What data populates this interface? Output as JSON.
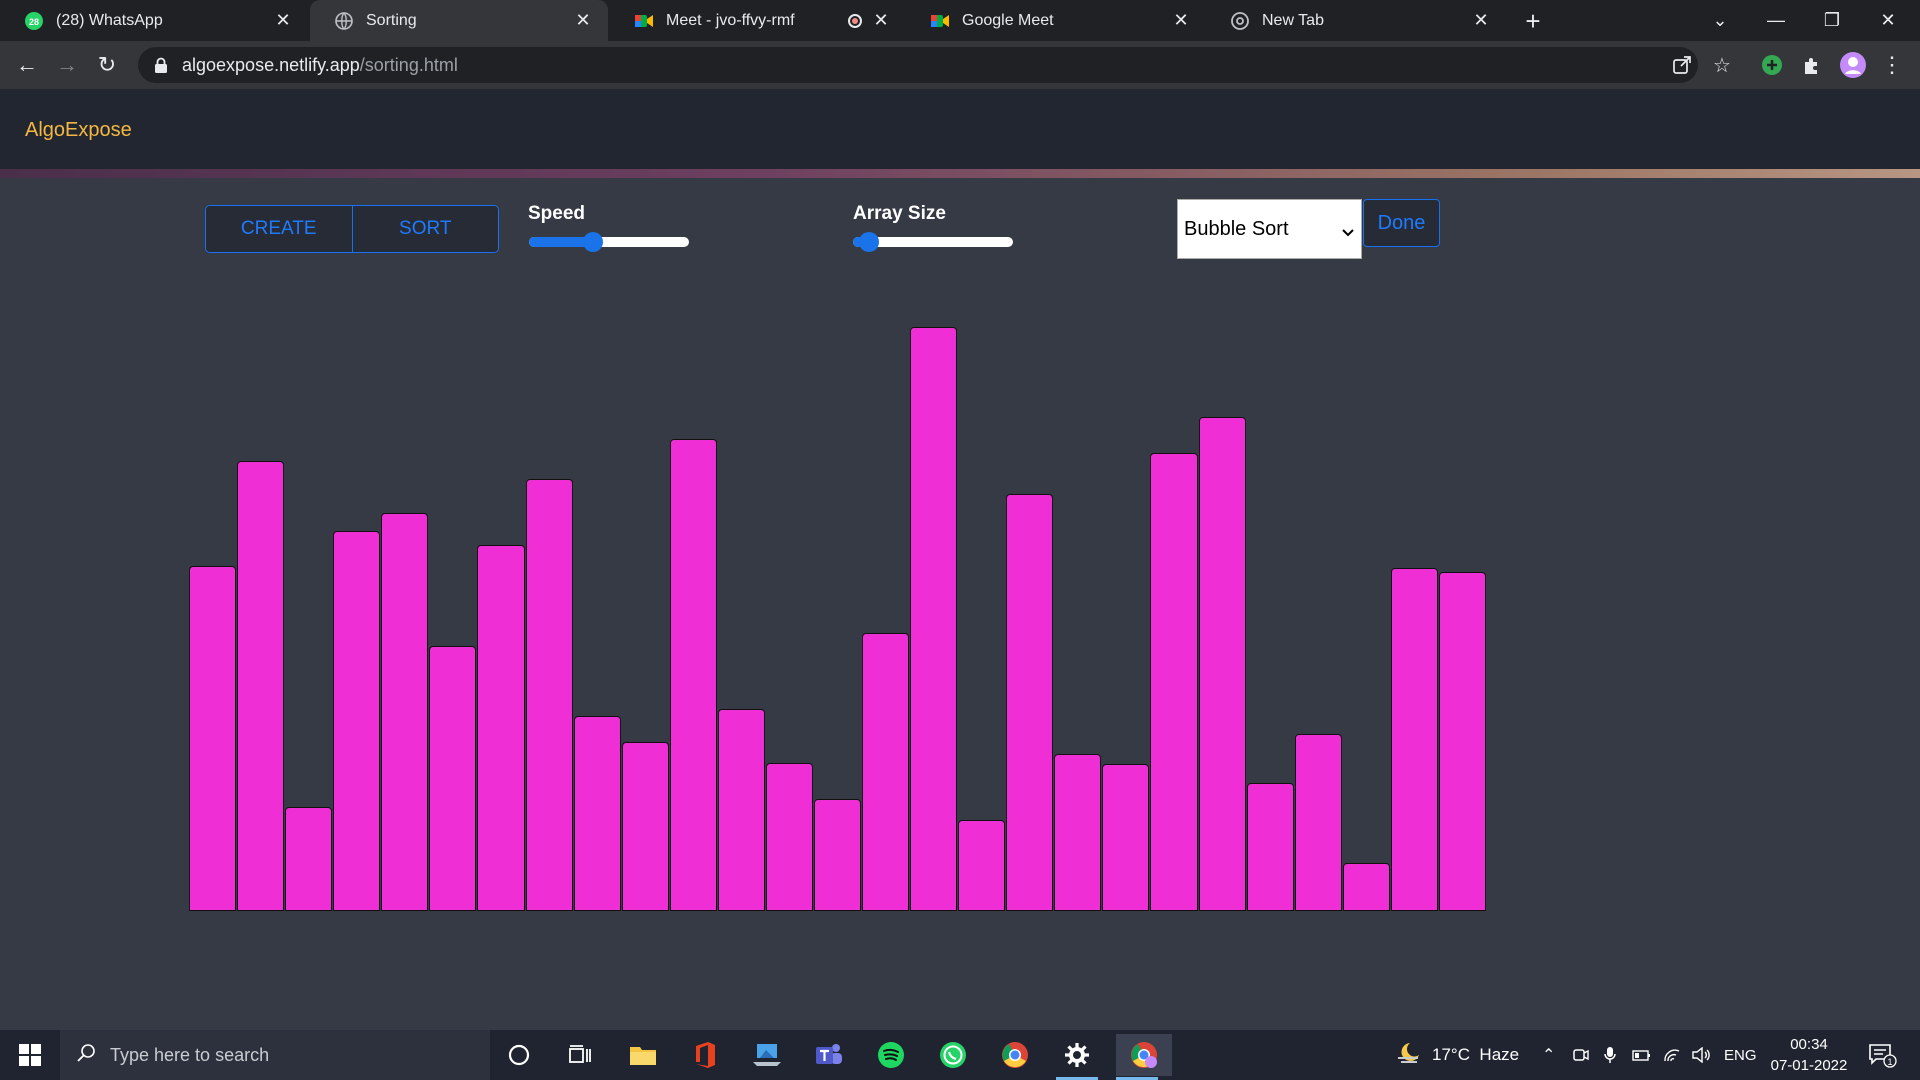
{
  "browser": {
    "tabs": [
      {
        "title": "(28) WhatsApp",
        "icon": "whatsapp-icon",
        "badge": "28"
      },
      {
        "title": "Sorting",
        "icon": "globe-icon"
      },
      {
        "title": "Meet - jvo-ffvy-rmf",
        "icon": "google-meet-icon"
      },
      {
        "title": "Google Meet",
        "icon": "google-meet-icon"
      },
      {
        "title": "New Tab",
        "icon": "chrome-icon"
      }
    ],
    "url_host": "algoexpose.netlify.app",
    "url_path": "/sorting.html"
  },
  "page": {
    "brand": "AlgoExpose",
    "create_label": "CREATE",
    "sort_label": "SORT",
    "speed_label": "Speed",
    "speed_value": 0.4,
    "array_size_label": "Array Size",
    "array_size_value": 0.1,
    "algorithm": "Bubble Sort",
    "done_label": "Done",
    "bar_color": "#f02ed6",
    "bars": [
      343,
      448,
      103,
      378,
      396,
      264,
      364,
      430,
      194,
      168,
      470,
      201,
      147,
      111,
      277,
      581,
      91,
      415,
      156,
      146,
      456,
      491,
      127,
      176,
      48,
      341,
      337
    ]
  },
  "taskbar": {
    "search_placeholder": "Type here to search",
    "weather": "17°C  Haze",
    "language": "ENG",
    "time": "00:34",
    "date": "07-01-2022",
    "notification_count": "1"
  }
}
